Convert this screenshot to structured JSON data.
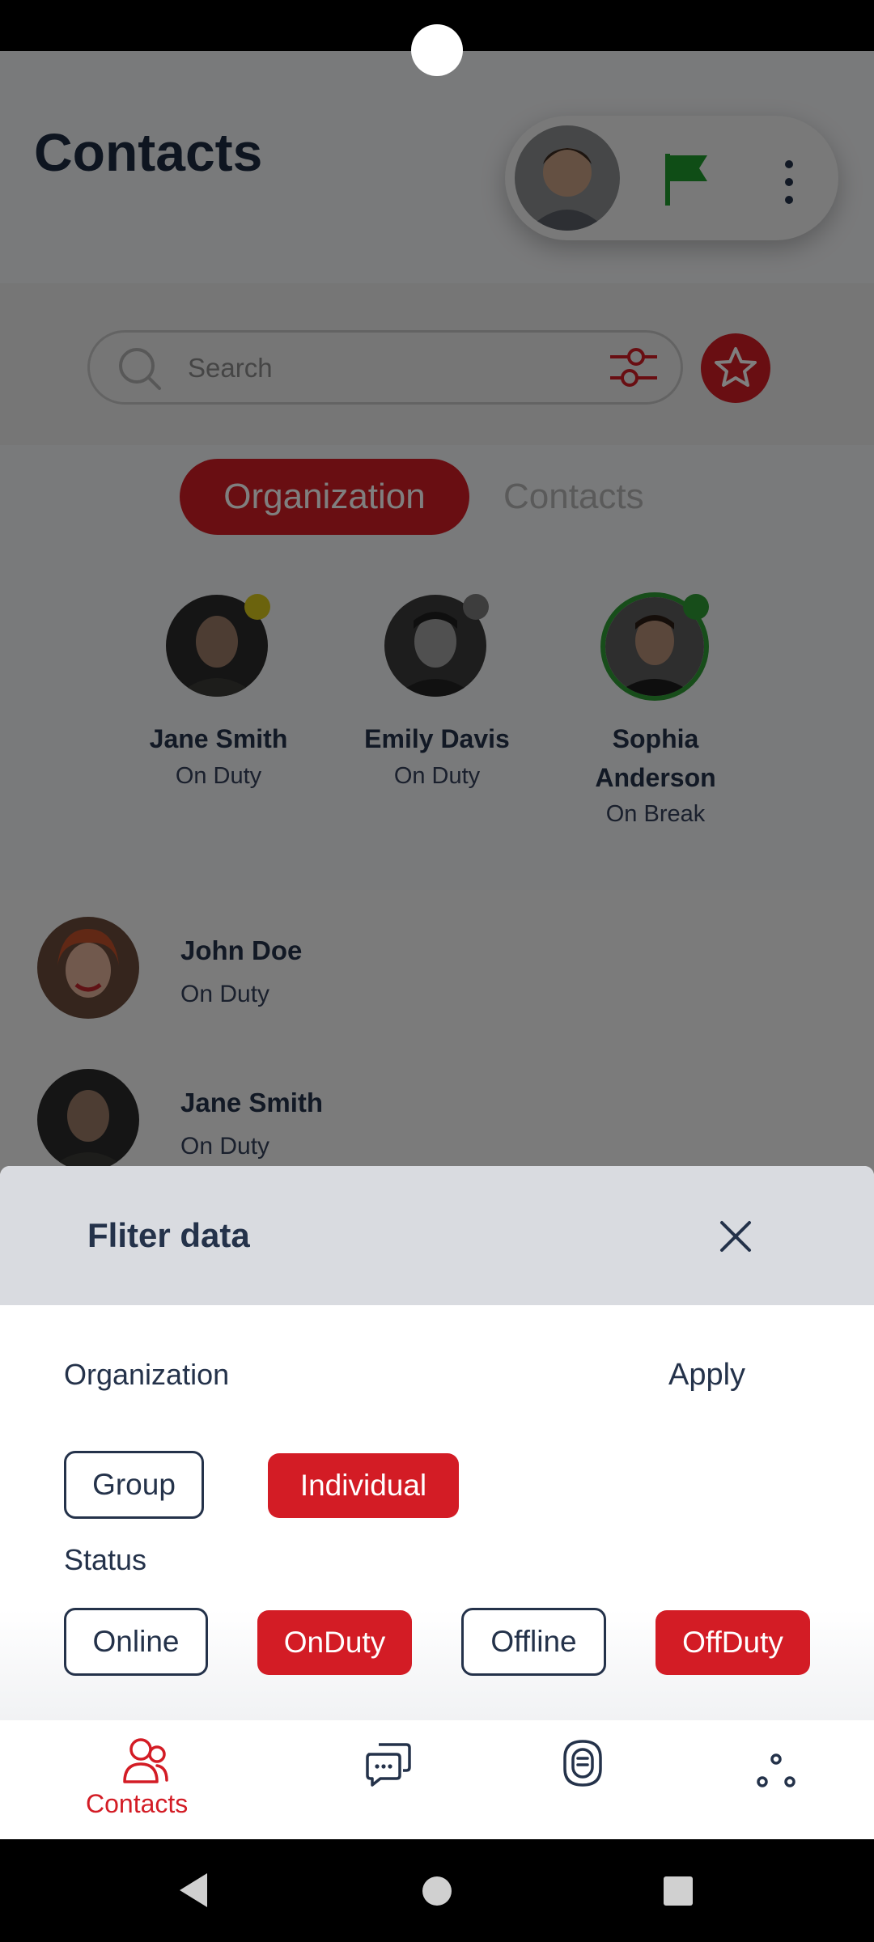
{
  "header": {
    "title": "Contacts"
  },
  "search": {
    "placeholder": "Search"
  },
  "tabs": [
    {
      "label": "Organization",
      "active": true
    },
    {
      "label": "Contacts",
      "active": false
    }
  ],
  "featured": [
    {
      "name": "Jane Smith",
      "status": "On Duty",
      "dot_color": "#d6c71a"
    },
    {
      "name": "Emily Davis",
      "status": "On Duty",
      "dot_color": "#7a7a7a"
    },
    {
      "name_line1": "Sophia",
      "name_line2": "Anderson",
      "status": "On Break",
      "dot_color": "#2f9a35"
    }
  ],
  "contacts": [
    {
      "name": "John Doe",
      "status": "On Duty"
    },
    {
      "name": "Jane Smith",
      "status": "On Duty"
    }
  ],
  "filter": {
    "title": "Fliter data",
    "organization_label": "Organization",
    "apply_label": "Apply",
    "org_options": [
      {
        "label": "Group",
        "selected": false
      },
      {
        "label": "Individual",
        "selected": true
      }
    ],
    "status_label": "Status",
    "status_options": [
      {
        "label": "Online",
        "selected": false
      },
      {
        "label": "OnDuty",
        "selected": true
      },
      {
        "label": "Offline",
        "selected": false
      },
      {
        "label": "OffDuty",
        "selected": true
      }
    ]
  },
  "bottom_nav": {
    "contacts_label": "Contacts"
  },
  "colors": {
    "accent": "#d31c25",
    "text": "#24324a",
    "flag": "#1f9a2d"
  }
}
